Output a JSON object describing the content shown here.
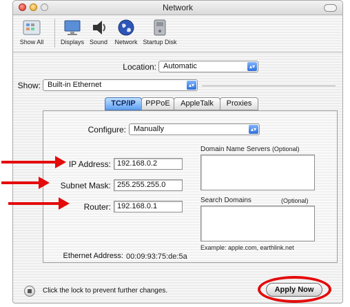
{
  "window": {
    "title": "Network"
  },
  "toolbar": {
    "items": [
      {
        "label": "Show All",
        "icon": "show-all-icon"
      },
      {
        "label": "Displays",
        "icon": "display-icon"
      },
      {
        "label": "Sound",
        "icon": "speaker-icon"
      },
      {
        "label": "Network",
        "icon": "globe-icon"
      },
      {
        "label": "Startup Disk",
        "icon": "disk-icon"
      }
    ]
  },
  "location": {
    "label": "Location:",
    "value": "Automatic"
  },
  "show": {
    "label": "Show:",
    "value": "Built-in Ethernet"
  },
  "tabs": [
    {
      "label": "TCP/IP",
      "selected": true
    },
    {
      "label": "PPPoE",
      "selected": false
    },
    {
      "label": "AppleTalk",
      "selected": false
    },
    {
      "label": "Proxies",
      "selected": false
    }
  ],
  "tcpip": {
    "configure_label": "Configure:",
    "configure_value": "Manually",
    "ip_label": "IP Address:",
    "ip_value": "192.168.0.2",
    "subnet_label": "Subnet Mask:",
    "subnet_value": "255.255.255.0",
    "router_label": "Router:",
    "router_value": "192.168.0.1",
    "dns_label": "Domain Name Servers",
    "dns_optional": "(Optional)",
    "search_label": "Search Domains",
    "search_optional": "(Optional)",
    "example": "Example: apple.com, earthlink.net",
    "ethernet_label": "Ethernet Address:",
    "ethernet_value": "00:09:93:75:de:5a"
  },
  "footer": {
    "lock_text": "Click the lock to prevent further changes.",
    "apply_label": "Apply Now"
  },
  "colors": {
    "annotation": "#e40b0b",
    "tab_selected": "#5f9ff0"
  }
}
